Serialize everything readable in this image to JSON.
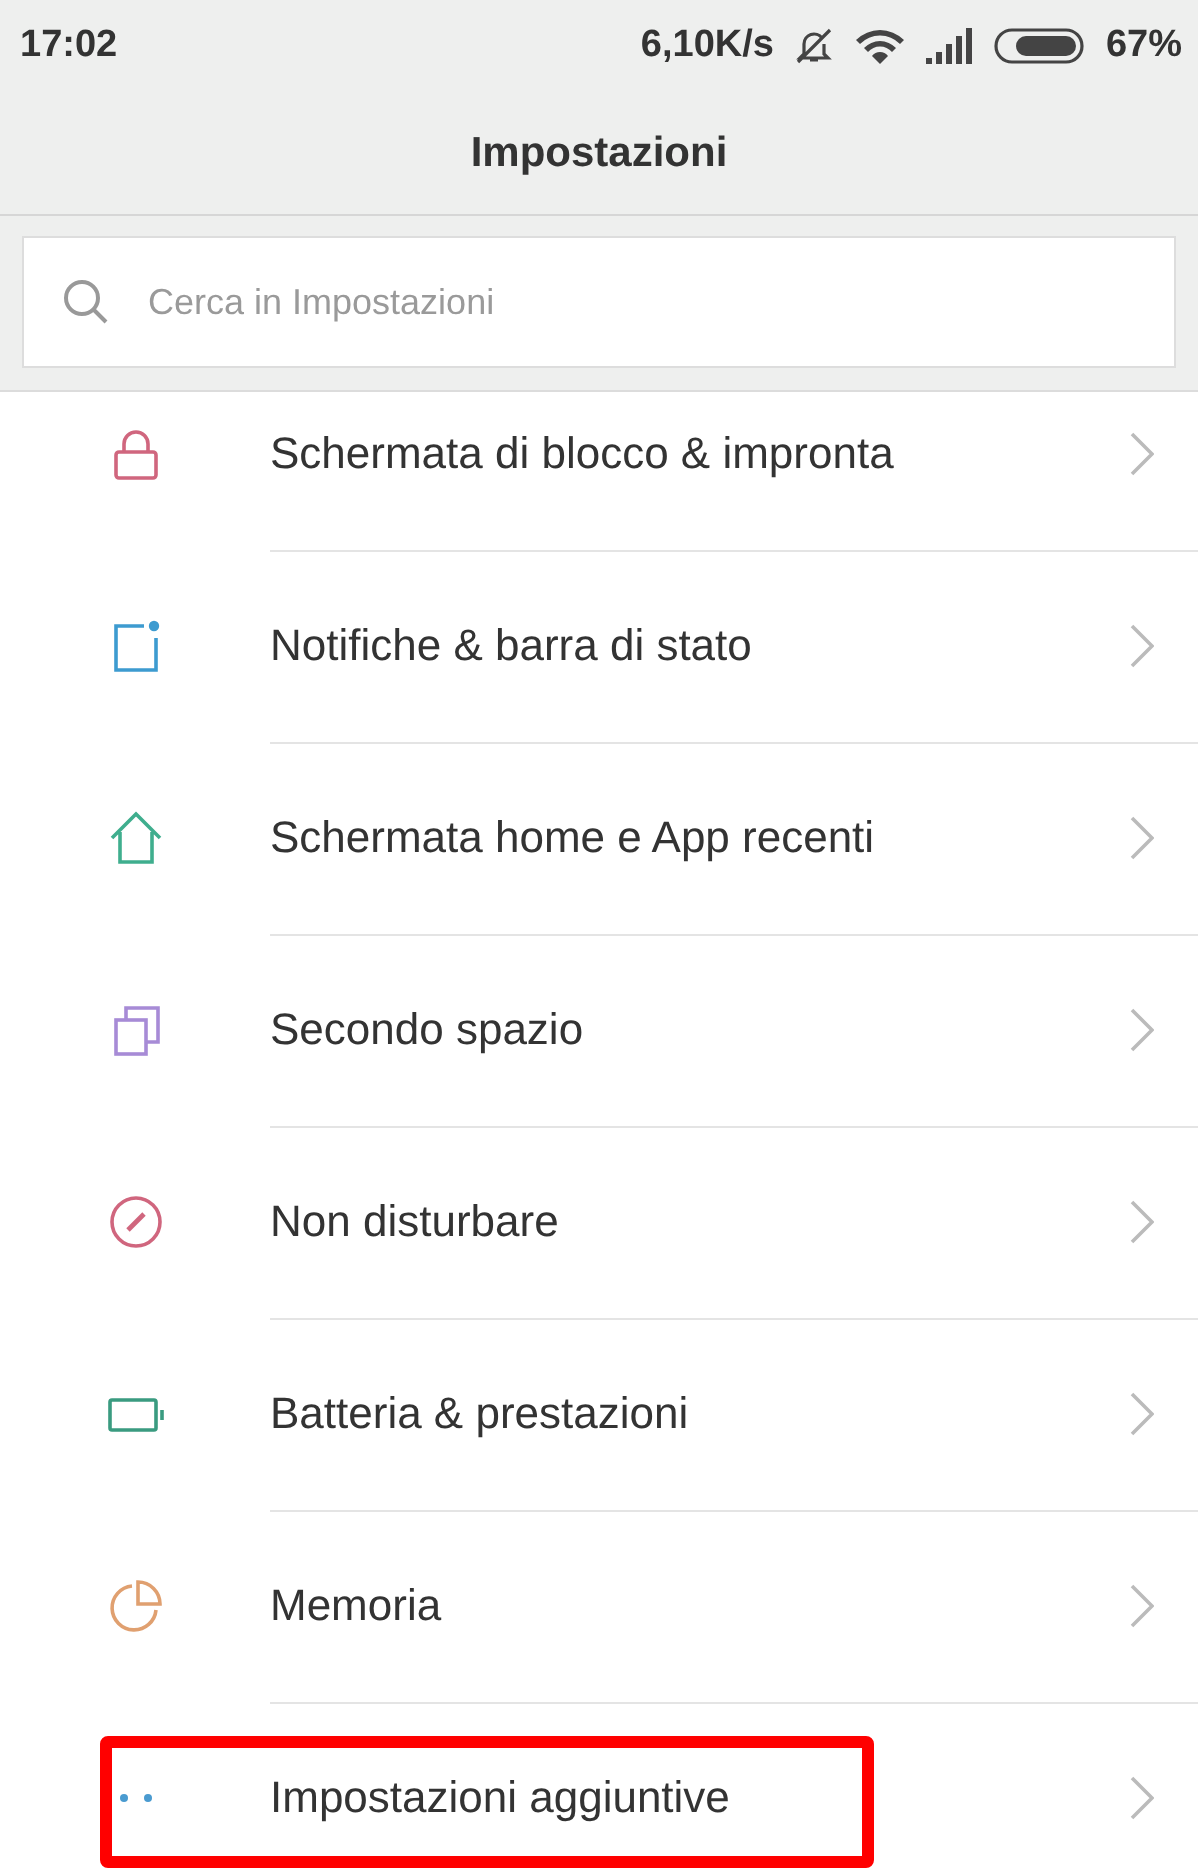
{
  "status_bar": {
    "time": "17:02",
    "speed": "6,10K/s",
    "battery": "67%"
  },
  "title": "Impostazioni",
  "search": {
    "placeholder": "Cerca in Impostazioni"
  },
  "items": [
    {
      "label": "Schermata di blocco & impronta",
      "kind": "lock",
      "color": "#d0667e",
      "highlighted": false
    },
    {
      "label": "Notifiche & barra di stato",
      "kind": "notification",
      "color": "#3d9bd0",
      "highlighted": false
    },
    {
      "label": "Schermata home e App recenti",
      "kind": "home",
      "color": "#3fae8e",
      "highlighted": false
    },
    {
      "label": "Secondo spazio",
      "kind": "copies",
      "color": "#a78bd6",
      "highlighted": false
    },
    {
      "label": "Non disturbare",
      "kind": "dnd",
      "color": "#d0667e",
      "highlighted": false
    },
    {
      "label": "Batteria & prestazioni",
      "kind": "battery",
      "color": "#3a9b80",
      "highlighted": false
    },
    {
      "label": "Memoria",
      "kind": "pie",
      "color": "#e0a070",
      "highlighted": false
    },
    {
      "label": "Impostazioni aggiuntive",
      "kind": "dots",
      "color": "#4a9bd0",
      "highlighted": true
    }
  ]
}
